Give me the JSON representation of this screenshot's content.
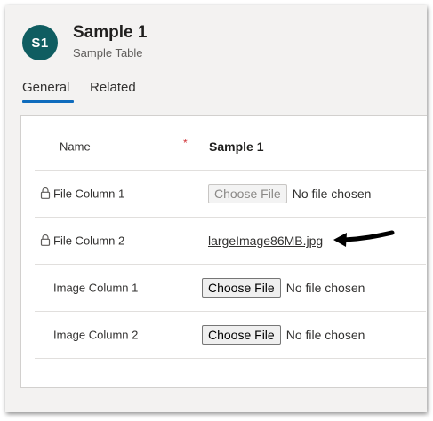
{
  "record": {
    "avatar_initials": "S1",
    "title": "Sample 1",
    "subtitle": "Sample Table"
  },
  "tabs": [
    {
      "label": "General",
      "selected": true
    },
    {
      "label": "Related",
      "selected": false
    }
  ],
  "fields": {
    "name": {
      "label": "Name",
      "required_marker": "*",
      "value": "Sample 1"
    },
    "file_column_1": {
      "label": "File Column 1",
      "locked": true,
      "button_label": "Choose File",
      "status": "No file chosen",
      "disabled": true
    },
    "file_column_2": {
      "label": "File Column 2",
      "locked": true,
      "file_name": "largeImage86MB.jpg"
    },
    "image_column_1": {
      "label": "Image Column 1",
      "button_label": "Choose File",
      "status": "No file chosen"
    },
    "image_column_2": {
      "label": "Image Column 2",
      "button_label": "Choose File",
      "status": "No file chosen"
    }
  },
  "colors": {
    "avatar_bg": "#0f5d61",
    "tab_underline": "#0f6cbd",
    "required": "#d13438"
  },
  "icons": [
    "lock-icon",
    "arrow-icon"
  ]
}
